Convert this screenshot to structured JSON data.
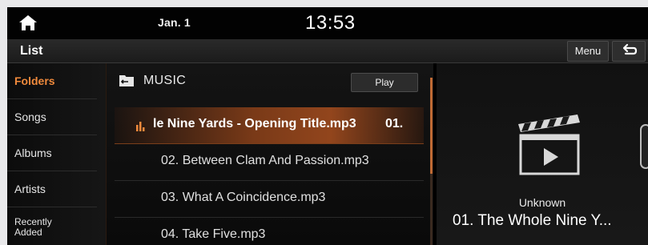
{
  "status": {
    "date": "Jan. 1",
    "time": "13:53"
  },
  "header": {
    "title": "List",
    "menu_label": "Menu"
  },
  "sidebar": {
    "items": [
      {
        "label": "Folders",
        "active": true
      },
      {
        "label": "Songs"
      },
      {
        "label": "Albums"
      },
      {
        "label": "Artists"
      },
      {
        "label": "Recently\nAdded"
      }
    ]
  },
  "folder": {
    "name": "MUSIC",
    "play_label": "Play"
  },
  "tracks": [
    {
      "name": "le Nine Yards - Opening Title.mp3",
      "number": "01.",
      "playing": true
    },
    {
      "name": "02. Between Clam And Passion.mp3"
    },
    {
      "name": "03. What A Coincidence.mp3"
    },
    {
      "name": "04. Take Five.mp3"
    }
  ],
  "now_playing": {
    "artist": "Unknown",
    "title": "01. The Whole Nine Y..."
  },
  "colors": {
    "accent": "#f08a3c",
    "playing_row": "#a04b1e",
    "background": "#000000"
  },
  "icons": [
    "home-icon",
    "back-icon",
    "folder-icon",
    "equalizer-icon",
    "clapperboard-icon",
    "play-icon"
  ]
}
